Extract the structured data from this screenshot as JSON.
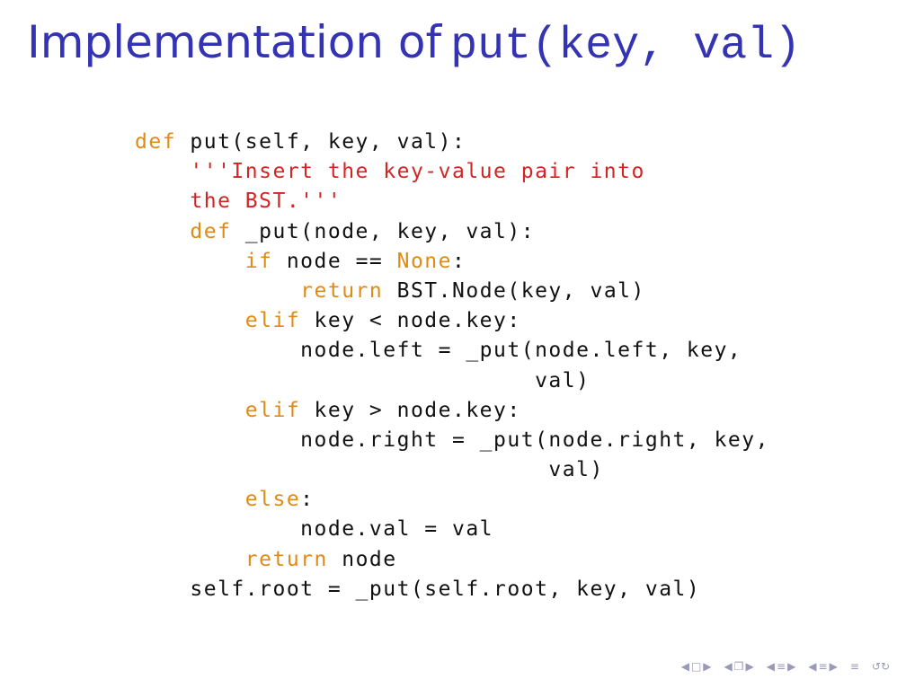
{
  "slide": {
    "title_text": "Implementation of",
    "title_code": "put(key, val)"
  },
  "code": {
    "lines": [
      {
        "indent": "",
        "tokens": [
          {
            "t": "def",
            "k": "kw"
          },
          {
            "t": " put(self, key, val):",
            "k": ""
          }
        ]
      },
      {
        "indent": "    ",
        "tokens": [
          {
            "t": "'''Insert the key-value pair into",
            "k": "str"
          }
        ]
      },
      {
        "indent": "    ",
        "tokens": [
          {
            "t": "the BST.'''",
            "k": "str"
          }
        ]
      },
      {
        "indent": "    ",
        "tokens": [
          {
            "t": "def",
            "k": "kw"
          },
          {
            "t": " _put(node, key, val):",
            "k": ""
          }
        ]
      },
      {
        "indent": "        ",
        "tokens": [
          {
            "t": "if",
            "k": "kw"
          },
          {
            "t": " node == ",
            "k": ""
          },
          {
            "t": "None",
            "k": "kw"
          },
          {
            "t": ":",
            "k": ""
          }
        ]
      },
      {
        "indent": "            ",
        "tokens": [
          {
            "t": "return",
            "k": "kw"
          },
          {
            "t": " BST.Node(key, val)",
            "k": ""
          }
        ]
      },
      {
        "indent": "        ",
        "tokens": [
          {
            "t": "elif",
            "k": "kw"
          },
          {
            "t": " key < node.key:",
            "k": ""
          }
        ]
      },
      {
        "indent": "            ",
        "tokens": [
          {
            "t": "node.left = _put(node.left, key,",
            "k": ""
          }
        ]
      },
      {
        "indent": "                             ",
        "tokens": [
          {
            "t": "val)",
            "k": ""
          }
        ]
      },
      {
        "indent": "        ",
        "tokens": [
          {
            "t": "elif",
            "k": "kw"
          },
          {
            "t": " key > node.key:",
            "k": ""
          }
        ]
      },
      {
        "indent": "            ",
        "tokens": [
          {
            "t": "node.right = _put(node.right, key,",
            "k": ""
          }
        ]
      },
      {
        "indent": "                              ",
        "tokens": [
          {
            "t": "val)",
            "k": ""
          }
        ]
      },
      {
        "indent": "        ",
        "tokens": [
          {
            "t": "else",
            "k": "kw"
          },
          {
            "t": ":",
            "k": ""
          }
        ]
      },
      {
        "indent": "            ",
        "tokens": [
          {
            "t": "node.val = val",
            "k": ""
          }
        ]
      },
      {
        "indent": "        ",
        "tokens": [
          {
            "t": "return",
            "k": "kw"
          },
          {
            "t": " node",
            "k": ""
          }
        ]
      },
      {
        "indent": "    ",
        "tokens": [
          {
            "t": "self.root = _put(self.root, key, val)",
            "k": ""
          }
        ]
      }
    ]
  },
  "colors": {
    "title": "#3333b3",
    "keyword": "#e08a17",
    "string": "#d42424",
    "text": "#111111",
    "nav": "#9a9ab8"
  },
  "nav": {
    "icons": [
      "nav-frame-prev-icon",
      "nav-frame-next-icon",
      "nav-subsection-prev-icon",
      "nav-subsection-next-icon",
      "nav-section-prev-icon",
      "nav-section-next-icon",
      "nav-slide-prev-icon",
      "nav-slide-next-icon",
      "nav-toc-icon",
      "nav-search-icon"
    ]
  }
}
